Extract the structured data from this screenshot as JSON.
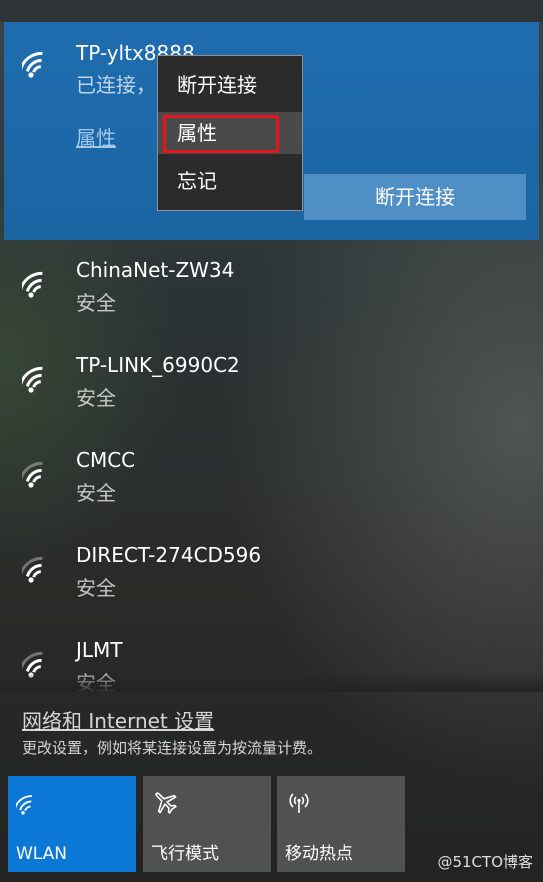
{
  "connected_network": {
    "ssid": "TP-yltx8888",
    "status": "已连接，",
    "properties_link": "属性",
    "disconnect_button": "断开连接",
    "icon": "wifi-icon"
  },
  "context_menu": {
    "items": [
      {
        "label": "断开连接"
      },
      {
        "label": "属性"
      },
      {
        "label": "忘记"
      }
    ]
  },
  "networks": [
    {
      "ssid": "ChinaNet-ZW34",
      "security": "安全",
      "signal": 3
    },
    {
      "ssid": "TP-LINK_6990C2",
      "security": "安全",
      "signal": 3
    },
    {
      "ssid": "CMCC",
      "security": "安全",
      "signal": 2
    },
    {
      "ssid": "DIRECT-274CD596",
      "security": "安全",
      "signal": 2
    },
    {
      "ssid": "JLMT",
      "security": "安全",
      "signal": 2
    }
  ],
  "footer": {
    "settings_link": "网络和 Internet 设置",
    "description": "更改设置，例如将某连接设置为按流量计费。"
  },
  "quick_actions": [
    {
      "label": "WLAN",
      "icon": "wifi-icon",
      "active": true
    },
    {
      "label": "飞行模式",
      "icon": "airplane-icon",
      "active": false
    },
    {
      "label": "移动热点",
      "icon": "hotspot-icon",
      "active": false
    }
  ],
  "watermark": "@51CTO博客",
  "colors": {
    "accent": "#0b78d7",
    "selected_bg": "#1d6aa8",
    "highlight_border": "#e8141b"
  }
}
